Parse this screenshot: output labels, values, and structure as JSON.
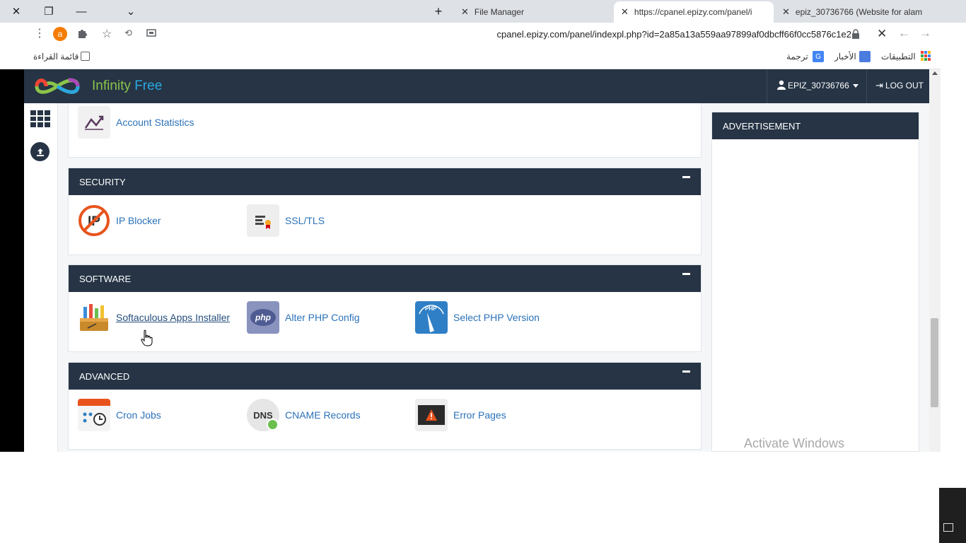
{
  "browser": {
    "tabs": [
      {
        "title": "File Manager"
      },
      {
        "title": "https://cpanel.epizy.com/panel/i"
      },
      {
        "title": "epiz_30736766 (Website for alam"
      }
    ],
    "address": "cpanel.epizy.com/panel/indexpl.php?id=2a85a13a559aa97899af0dbcff66f0cc5876c1e2",
    "profile_initial": "a",
    "bookmarks": {
      "apps": "التطبيقات",
      "news": "الأخبار",
      "translate": "ترجمة",
      "reading_list": "قائمة القراءة"
    }
  },
  "header": {
    "brand_infinity": "Infinity",
    "brand_free": "Free",
    "username": "EPIZ_30736766",
    "logout": "LOG OUT"
  },
  "statistics": {
    "account_statistics": "Account Statistics"
  },
  "security": {
    "title": "SECURITY",
    "ip_blocker": "IP Blocker",
    "ssl_tls": "SSL/TLS"
  },
  "software": {
    "title": "SOFTWARE",
    "softaculous": "Softaculous Apps Installer",
    "alter_php": "Alter PHP Config",
    "select_php": "Select PHP Version",
    "php_badge": "php",
    "php_gauge_label": "PHP"
  },
  "advanced": {
    "title": "ADVANCED",
    "cron_jobs": "Cron Jobs",
    "cname_records": "CNAME Records",
    "error_pages": "Error Pages",
    "dns_badge": "DNS"
  },
  "sidebar_ad": {
    "title": "ADVERTISEMENT"
  },
  "watermark": "Activate Windows",
  "colors": {
    "nav": "#263445",
    "link": "#2b72b8",
    "brand_green": "#8bc34a",
    "brand_blue": "#29a8e0"
  }
}
